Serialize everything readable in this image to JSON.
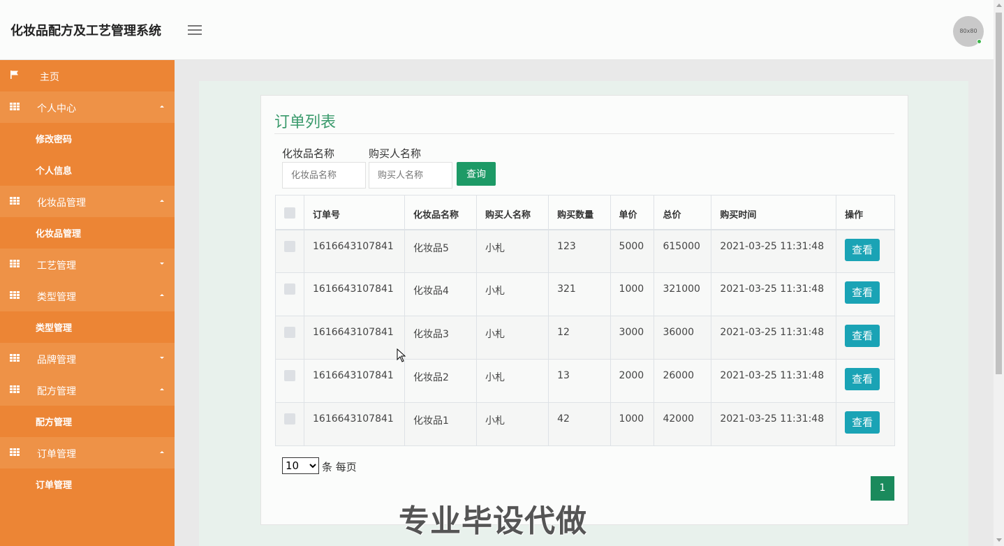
{
  "header": {
    "title": "化妆品配方及工艺管理系统",
    "avatar_text": "80x80"
  },
  "sidebar": {
    "items": [
      {
        "label": "主页",
        "type": "home",
        "icon": "flag-icon"
      },
      {
        "label": "个人中心",
        "type": "group",
        "icon": "grid-icon",
        "caret": "up"
      },
      {
        "label": "修改密码",
        "type": "sub"
      },
      {
        "label": "个人信息",
        "type": "sub"
      },
      {
        "label": "化妆品管理",
        "type": "group",
        "icon": "grid-icon",
        "caret": "up"
      },
      {
        "label": "化妆品管理",
        "type": "sub"
      },
      {
        "label": "工艺管理",
        "type": "group",
        "icon": "grid-icon",
        "caret": "down"
      },
      {
        "label": "类型管理",
        "type": "group",
        "icon": "grid-icon",
        "caret": "up"
      },
      {
        "label": "类型管理",
        "type": "sub"
      },
      {
        "label": "品牌管理",
        "type": "group",
        "icon": "grid-icon",
        "caret": "down"
      },
      {
        "label": "配方管理",
        "type": "group",
        "icon": "grid-icon",
        "caret": "up"
      },
      {
        "label": "配方管理",
        "type": "sub"
      },
      {
        "label": "订单管理",
        "type": "group",
        "icon": "grid-icon",
        "caret": "up"
      },
      {
        "label": "订单管理",
        "type": "sub"
      }
    ]
  },
  "panel": {
    "title": "订单列表",
    "search": {
      "field1_label": "化妆品名称",
      "field1_placeholder": "化妆品名称",
      "field2_label": "购买人名称",
      "field2_placeholder": "购买人名称",
      "button_label": "查询"
    },
    "table": {
      "headers": [
        "订单号",
        "化妆品名称",
        "购买人名称",
        "购买数量",
        "单价",
        "总价",
        "购买时间",
        "操作"
      ],
      "rows": [
        {
          "order": "1616643107841",
          "product": "化妆品5",
          "buyer": "小札",
          "qty": "123",
          "price": "5000",
          "total": "615000",
          "time": "2021-03-25 11:31:48",
          "action": "查看"
        },
        {
          "order": "1616643107841",
          "product": "化妆品4",
          "buyer": "小札",
          "qty": "321",
          "price": "1000",
          "total": "321000",
          "time": "2021-03-25 11:31:48",
          "action": "查看"
        },
        {
          "order": "1616643107841",
          "product": "化妆品3",
          "buyer": "小札",
          "qty": "12",
          "price": "3000",
          "total": "36000",
          "time": "2021-03-25 11:31:48",
          "action": "查看"
        },
        {
          "order": "1616643107841",
          "product": "化妆品2",
          "buyer": "小札",
          "qty": "13",
          "price": "2000",
          "total": "26000",
          "time": "2021-03-25 11:31:48",
          "action": "查看"
        },
        {
          "order": "1616643107841",
          "product": "化妆品1",
          "buyer": "小札",
          "qty": "42",
          "price": "1000",
          "total": "42000",
          "time": "2021-03-25 11:31:48",
          "action": "查看"
        }
      ]
    },
    "pagination": {
      "page_size": "10",
      "page_size_suffix": "条 每页",
      "current_page": "1"
    }
  },
  "watermark": "专业毕设代做"
}
